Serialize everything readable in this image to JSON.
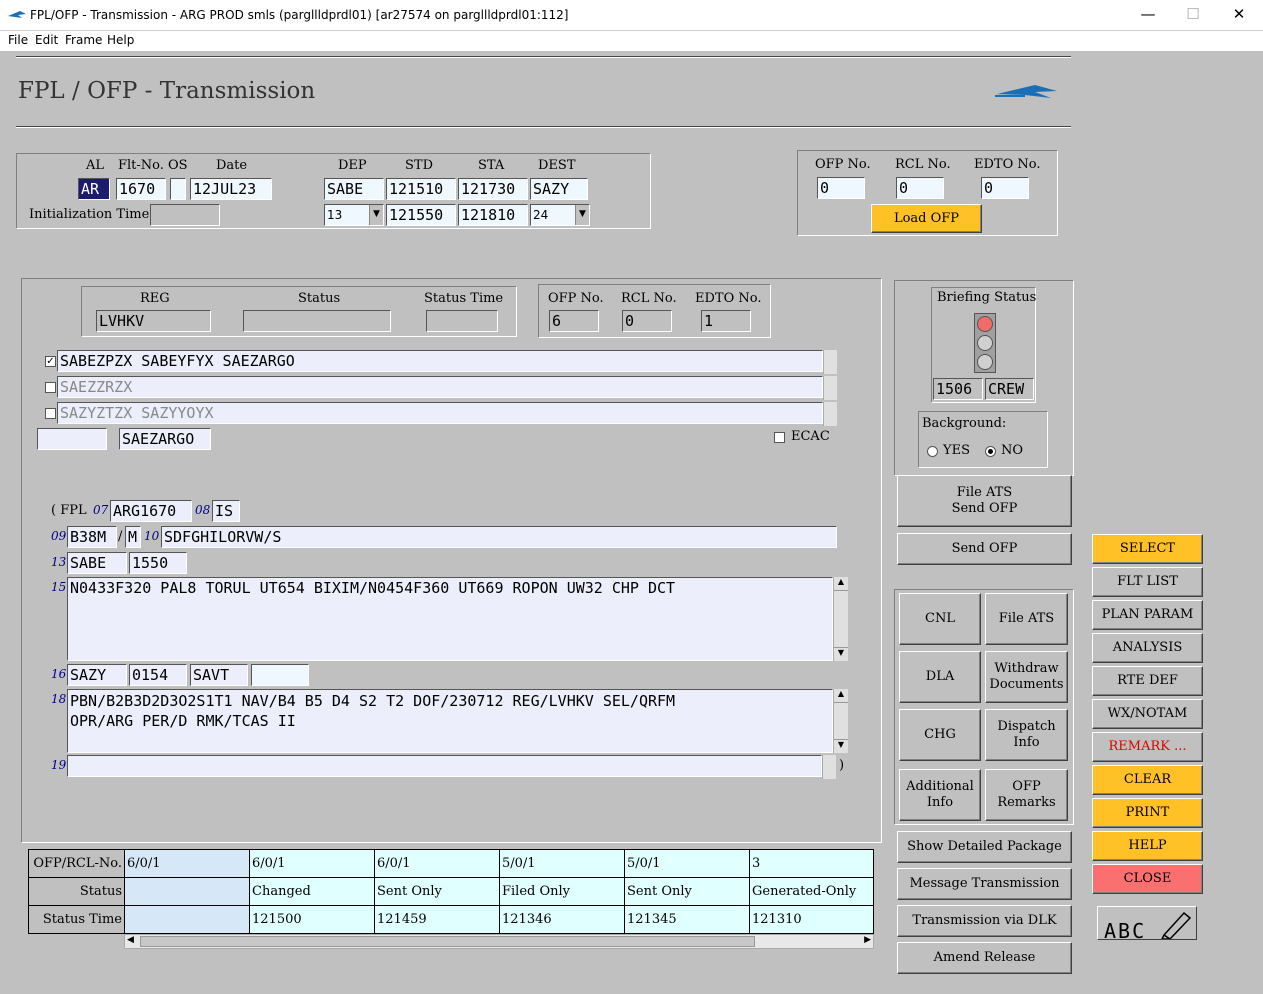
{
  "window": {
    "title": "FPL/OFP - Transmission - ARG PROD smls (pargllldprdl01) [ar27574 on pargllldprdl01:112]",
    "min": "—",
    "max": "☐",
    "close": "✕"
  },
  "menu": [
    "File",
    "Edit",
    "Frame",
    "Help"
  ],
  "page_title": "FPL / OFP - Transmission",
  "flight": {
    "labels": {
      "al": "AL",
      "flt": "Flt-No.",
      "os": "OS",
      "date": "Date",
      "dep": "DEP",
      "std": "STD",
      "sta": "STA",
      "dest": "DEST",
      "init": "Initialization Time"
    },
    "al": "AR",
    "flt": "1670",
    "os": "",
    "date": "12JUL23",
    "dep": "SABE",
    "std": "121510",
    "sta": "121730",
    "dest": "SAZY",
    "dep_sel": "13",
    "std2": "121550",
    "sta2": "121810",
    "dest_sel": "24",
    "init_time": ""
  },
  "ofp_top": {
    "labels": {
      "ofp": "OFP No.",
      "rcl": "RCL No.",
      "edto": "EDTO No."
    },
    "ofp": "0",
    "rcl": "0",
    "edto": "0",
    "load": "Load OFP"
  },
  "reg_box": {
    "labels": {
      "reg": "REG",
      "status": "Status",
      "status_time": "Status Time"
    },
    "reg": "LVHKV",
    "status": "",
    "status_time": ""
  },
  "ofp_mid": {
    "labels": {
      "ofp": "OFP No.",
      "rcl": "RCL No.",
      "edto": "EDTO No."
    },
    "ofp": "6",
    "rcl": "0",
    "edto": "1"
  },
  "addresses": [
    {
      "checked": true,
      "text": "SABEZPZX SABEYFYX SAEZARGO"
    },
    {
      "checked": false,
      "text": "SAEZZRZX"
    },
    {
      "checked": false,
      "text": "SAZYZTZX SAZYYOYX"
    }
  ],
  "addr_extra": {
    "left": "",
    "right": "SAEZARGO",
    "ecac": "ECAC"
  },
  "fpl": {
    "open": "( FPL",
    "n07": "07",
    "callsign": "ARG1670",
    "n08": "08",
    "rules": "IS",
    "n09": "09",
    "actype": "B38M",
    "slash": "/",
    "wake": "M",
    "n10": "10",
    "equip": "SDFGHILORVW/S",
    "n13": "13",
    "dep": "SABE",
    "time": "1550",
    "n15": "15",
    "route": "N0433F320 PAL8 TORUL UT654 BIXIM/N0454F360 UT669 ROPON UW32 CHP DCT",
    "n16": "16",
    "dest": "SAZY",
    "eet": "0154",
    "altn": "SAVT",
    "altn2": "",
    "n18": "18",
    "other_l1": "PBN/B2B3D2D3O2S1T1 NAV/B4 B5 D4 S2 T2 DOF/230712 REG/LVHKV SEL/QRFM",
    "other_l2": "OPR/ARG PER/D RMK/TCAS II",
    "n19": "19",
    "f19": "",
    "close": ")"
  },
  "briefing": {
    "title": "Briefing Status",
    "num": "1506",
    "crew": "CREW"
  },
  "background": {
    "title": "Background:",
    "yes": "YES",
    "no": "NO",
    "selected": "NO"
  },
  "buttons_mid": {
    "file_send_l1": "File ATS",
    "file_send_l2": "Send OFP",
    "send_ofp": "Send OFP"
  },
  "grid_buttons": [
    [
      "CNL"
    ],
    [
      "File ATS"
    ],
    [
      "DLA"
    ],
    [
      "Withdraw",
      "Documents"
    ],
    [
      "CHG"
    ],
    [
      "Dispatch",
      "Info"
    ],
    [
      "Additional",
      "Info"
    ],
    [
      "OFP",
      "Remarks"
    ]
  ],
  "buttons_low": [
    "Show Detailed Package",
    "Message Transmission",
    "Transmission via DLK",
    "Amend Release"
  ],
  "right_buttons": [
    {
      "label": "SELECT",
      "color": "yellow"
    },
    {
      "label": "FLT LIST",
      "color": "gray"
    },
    {
      "label": "PLAN PARAM",
      "color": "gray"
    },
    {
      "label": "ANALYSIS",
      "color": "gray"
    },
    {
      "label": "RTE DEF",
      "color": "gray"
    },
    {
      "label": "WX/NOTAM",
      "color": "gray"
    },
    {
      "label": "REMARK ...",
      "color": "gray-red"
    },
    {
      "label": "CLEAR",
      "color": "yellow"
    },
    {
      "label": "PRINT",
      "color": "yellow"
    },
    {
      "label": "HELP",
      "color": "yellow"
    },
    {
      "label": "CLOSE",
      "color": "red"
    }
  ],
  "abc": "ABC",
  "status_table": {
    "row_labels": [
      "OFP/RCL-No.",
      "Status",
      "Status Time"
    ],
    "cols": [
      {
        "ofp": "6/0/1",
        "status": "",
        "time": ""
      },
      {
        "ofp": "6/0/1",
        "status": "Changed",
        "time": "121500"
      },
      {
        "ofp": "6/0/1",
        "status": "Sent Only",
        "time": "121459"
      },
      {
        "ofp": "5/0/1",
        "status": "Filed Only",
        "time": "121346"
      },
      {
        "ofp": "5/0/1",
        "status": "Sent Only",
        "time": "121345"
      },
      {
        "ofp": "3",
        "status": "Generated-Only",
        "time": "121310"
      }
    ]
  },
  "colors": {
    "yellow": "#ffc125",
    "red": "#fa6f6f",
    "field": "#f0f8ff",
    "lavender": "#eceefb"
  }
}
